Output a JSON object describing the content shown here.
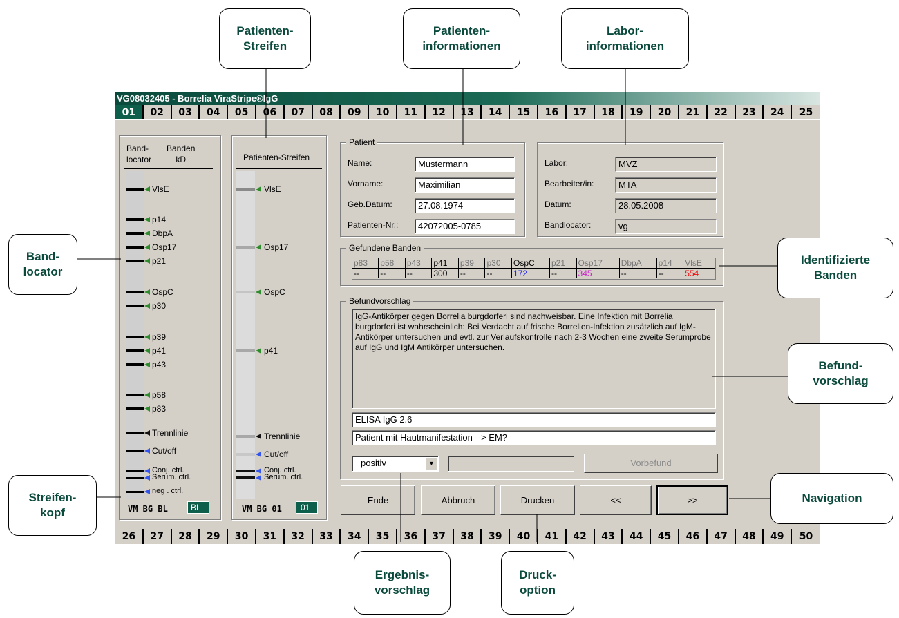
{
  "window": {
    "title": "VG08032405 - Borrelia ViraStripe®IgG"
  },
  "tabs_top": [
    "01",
    "02",
    "03",
    "04",
    "05",
    "06",
    "07",
    "08",
    "09",
    "10",
    "11",
    "12",
    "13",
    "14",
    "15",
    "16",
    "17",
    "18",
    "19",
    "20",
    "21",
    "22",
    "23",
    "24",
    "25"
  ],
  "tabs_bottom": [
    "26",
    "27",
    "28",
    "29",
    "30",
    "31",
    "32",
    "33",
    "34",
    "35",
    "36",
    "37",
    "38",
    "39",
    "40",
    "41",
    "42",
    "43",
    "44",
    "45",
    "46",
    "47",
    "48",
    "49",
    "50"
  ],
  "bandlocator": {
    "header_col1": "Band-\nlocator",
    "header_col2": "Banden\nkD",
    "bands": [
      "VlsE",
      "p14",
      "DbpA",
      "Osp17",
      "p21",
      "OspC",
      "p30",
      "p39",
      "p41",
      "p43",
      "p58",
      "p83",
      "Trennlinie",
      "Cut/off",
      "Conj. ctrl.",
      "Serum. ctrl.",
      "neg . ctrl."
    ],
    "footer_code": "VM BG BL",
    "footer_tag": "BL"
  },
  "patient_strip": {
    "header": "Patienten-Streifen",
    "bands": [
      "VlsE",
      "Osp17",
      "OspC",
      "p41",
      "Trennlinie",
      "Cut/off",
      "Conj. ctrl.",
      "Serum. ctrl."
    ],
    "footer_code": "VM BG 01",
    "footer_tag": "01"
  },
  "patient": {
    "group_label": "Patient",
    "name_label": "Name:",
    "name_value": "Mustermann",
    "vorname_label": "Vorname:",
    "vorname_value": "Maximilian",
    "geb_label": "Geb.Datum:",
    "geb_value": "27.08.1974",
    "nr_label": "Patienten-Nr.:",
    "nr_value": "42072005-0785"
  },
  "labor": {
    "labor_label": "Labor:",
    "labor_value": "MVZ",
    "bearbeiter_label": "Bearbeiter/in:",
    "bearbeiter_value": "MTA",
    "datum_label": "Datum:",
    "datum_value": "28.05.2008",
    "bandlocator_label": "Bandlocator:",
    "bandlocator_value": "vg"
  },
  "gefundene_banden": {
    "group_label": "Gefundene Banden",
    "headers": [
      "p83",
      "p58",
      "p43",
      "p41",
      "p39",
      "p30",
      "OspC",
      "p21",
      "Osp17",
      "DbpA",
      "p14",
      "VlsE"
    ],
    "values": [
      "--",
      "--",
      "--",
      "300",
      "--",
      "--",
      "172",
      "--",
      "345",
      "--",
      "--",
      "554"
    ],
    "value_colors": [
      "#000",
      "#000",
      "#000",
      "#000",
      "#000",
      "#000",
      "#2222ee",
      "#000",
      "#cc22cc",
      "#000",
      "#000",
      "#ee1111"
    ],
    "header_colors": [
      "#777",
      "#777",
      "#777",
      "#000",
      "#777",
      "#777",
      "#000",
      "#777",
      "#777",
      "#777",
      "#777",
      "#777"
    ]
  },
  "befund": {
    "group_label": "Befundvorschlag",
    "text": "IgG-Antikörper gegen Borrelia burgdorferi sind nachweisbar. Eine Infektion mit Borrelia burgdorferi ist wahrscheinlich: Bei Verdacht auf frische Borrelien-Infektion zusätzlich auf IgM-Antikörper untersuchen und evtl. zur Verlaufskontrolle nach 2-3 Wochen eine zweite Serumprobe auf IgG und IgM Antikörper untersuchen.",
    "elisa": "ELISA  IgG 2.6",
    "comment": "Patient mit Hautmanifestation --> EM?",
    "result_select": "positiv",
    "vorbefund_button": "Vorbefund"
  },
  "nav": {
    "ende": "Ende",
    "abbruch": "Abbruch",
    "drucken": "Drucken",
    "prev": "<<",
    "next": ">>"
  },
  "callouts": {
    "patienten_streifen": "Patienten-\nStreifen",
    "patienten_info": "Patienten-\ninformationen",
    "labor_info": "Labor-\ninformationen",
    "bandlocator": "Band-\nlocator",
    "identifizierte": "Identifizierte\nBanden",
    "befundvorschlag": "Befund-\nvorschlag",
    "streifenkopf": "Streifen-\nkopf",
    "navigation": "Navigation",
    "ergebnis": "Ergebnis-\nvorschlag",
    "druck": "Druck-\noption"
  }
}
